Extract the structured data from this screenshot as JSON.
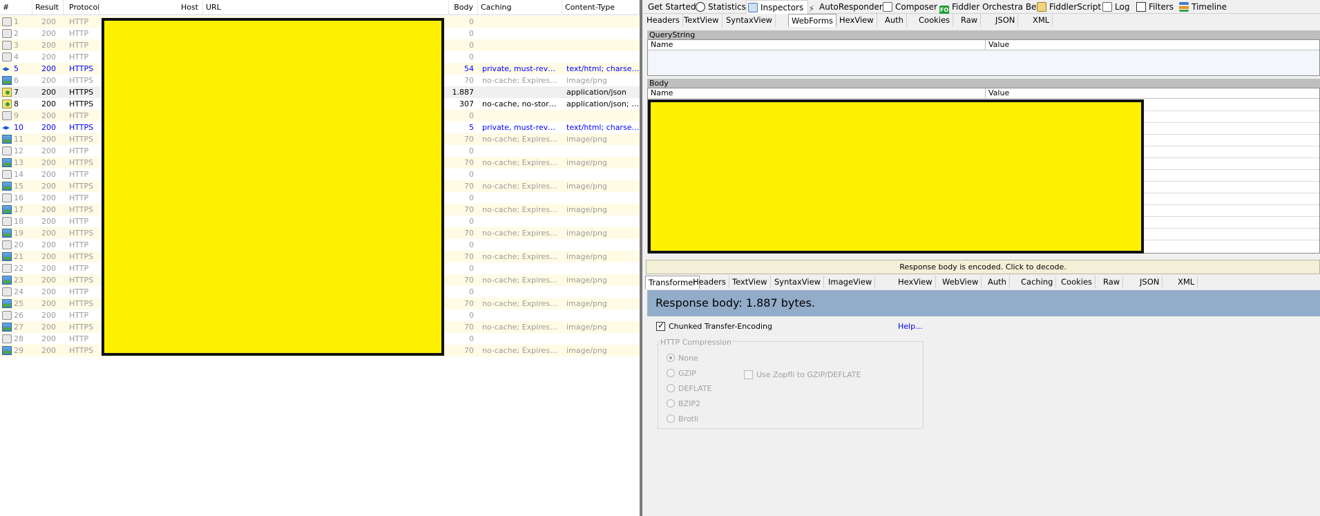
{
  "sessions": {
    "columns": [
      "#",
      "Result",
      "Protocol",
      "Host",
      "URL",
      "Body",
      "Caching",
      "Content-Type"
    ],
    "rows": [
      {
        "num": "1",
        "result": "200",
        "protocol": "HTTP",
        "body": "0",
        "caching": "",
        "ctype": "",
        "icon": "lock-icon",
        "style": "grey"
      },
      {
        "num": "2",
        "result": "200",
        "protocol": "HTTP",
        "body": "0",
        "caching": "",
        "ctype": "",
        "icon": "lock-icon",
        "style": "grey"
      },
      {
        "num": "3",
        "result": "200",
        "protocol": "HTTP",
        "body": "0",
        "caching": "",
        "ctype": "",
        "icon": "lock-icon",
        "style": "grey"
      },
      {
        "num": "4",
        "result": "200",
        "protocol": "HTTP",
        "body": "0",
        "caching": "",
        "ctype": "",
        "icon": "lock-icon",
        "style": "grey"
      },
      {
        "num": "5",
        "result": "200",
        "protocol": "HTTPS",
        "body": "54",
        "caching": "private, must-revali...",
        "ctype": "text/html; charset=UT",
        "icon": "web-arrows-icon",
        "style": "blue"
      },
      {
        "num": "6",
        "result": "200",
        "protocol": "HTTPS",
        "body": "70",
        "caching": "no-cache; Expires: -1",
        "ctype": "image/png",
        "icon": "image-icon",
        "style": "grey"
      },
      {
        "num": "7",
        "result": "200",
        "protocol": "HTTPS",
        "body": "1.887",
        "caching": "",
        "ctype": "application/json",
        "icon": "json-icon",
        "style": "black"
      },
      {
        "num": "8",
        "result": "200",
        "protocol": "HTTPS",
        "body": "307",
        "caching": "no-cache, no-store,...",
        "ctype": "application/json; chars",
        "icon": "json-icon",
        "style": "black"
      },
      {
        "num": "9",
        "result": "200",
        "protocol": "HTTP",
        "body": "0",
        "caching": "",
        "ctype": "",
        "icon": "lock-icon",
        "style": "grey"
      },
      {
        "num": "10",
        "result": "200",
        "protocol": "HTTPS",
        "body": "5",
        "caching": "private, must-revali...",
        "ctype": "text/html; charset=UT",
        "icon": "web-arrows-icon",
        "style": "blue"
      },
      {
        "num": "11",
        "result": "200",
        "protocol": "HTTPS",
        "body": "70",
        "caching": "no-cache; Expires: -1",
        "ctype": "image/png",
        "icon": "image-icon",
        "style": "grey"
      },
      {
        "num": "12",
        "result": "200",
        "protocol": "HTTP",
        "body": "0",
        "caching": "",
        "ctype": "",
        "icon": "lock-icon",
        "style": "grey"
      },
      {
        "num": "13",
        "result": "200",
        "protocol": "HTTPS",
        "body": "70",
        "caching": "no-cache; Expires: -1",
        "ctype": "image/png",
        "icon": "image-icon",
        "style": "grey"
      },
      {
        "num": "14",
        "result": "200",
        "protocol": "HTTP",
        "body": "0",
        "caching": "",
        "ctype": "",
        "icon": "lock-icon",
        "style": "grey"
      },
      {
        "num": "15",
        "result": "200",
        "protocol": "HTTPS",
        "body": "70",
        "caching": "no-cache; Expires: -1",
        "ctype": "image/png",
        "icon": "image-icon",
        "style": "grey"
      },
      {
        "num": "16",
        "result": "200",
        "protocol": "HTTP",
        "body": "0",
        "caching": "",
        "ctype": "",
        "icon": "lock-icon",
        "style": "grey"
      },
      {
        "num": "17",
        "result": "200",
        "protocol": "HTTPS",
        "body": "70",
        "caching": "no-cache; Expires: -1",
        "ctype": "image/png",
        "icon": "image-icon",
        "style": "grey"
      },
      {
        "num": "18",
        "result": "200",
        "protocol": "HTTP",
        "body": "0",
        "caching": "",
        "ctype": "",
        "icon": "lock-icon",
        "style": "grey"
      },
      {
        "num": "19",
        "result": "200",
        "protocol": "HTTPS",
        "body": "70",
        "caching": "no-cache; Expires: -1",
        "ctype": "image/png",
        "icon": "image-icon",
        "style": "grey"
      },
      {
        "num": "20",
        "result": "200",
        "protocol": "HTTP",
        "body": "0",
        "caching": "",
        "ctype": "",
        "icon": "lock-icon",
        "style": "grey"
      },
      {
        "num": "21",
        "result": "200",
        "protocol": "HTTPS",
        "body": "70",
        "caching": "no-cache; Expires: -1",
        "ctype": "image/png",
        "icon": "image-icon",
        "style": "grey"
      },
      {
        "num": "22",
        "result": "200",
        "protocol": "HTTP",
        "body": "0",
        "caching": "",
        "ctype": "",
        "icon": "lock-icon",
        "style": "grey"
      },
      {
        "num": "23",
        "result": "200",
        "protocol": "HTTPS",
        "body": "70",
        "caching": "no-cache; Expires: -1",
        "ctype": "image/png",
        "icon": "image-icon",
        "style": "grey"
      },
      {
        "num": "24",
        "result": "200",
        "protocol": "HTTP",
        "body": "0",
        "caching": "",
        "ctype": "",
        "icon": "lock-icon",
        "style": "grey"
      },
      {
        "num": "25",
        "result": "200",
        "protocol": "HTTPS",
        "body": "70",
        "caching": "no-cache; Expires: -1",
        "ctype": "image/png",
        "icon": "image-icon",
        "style": "grey"
      },
      {
        "num": "26",
        "result": "200",
        "protocol": "HTTP",
        "body": "0",
        "caching": "",
        "ctype": "",
        "icon": "lock-icon",
        "style": "grey"
      },
      {
        "num": "27",
        "result": "200",
        "protocol": "HTTPS",
        "body": "70",
        "caching": "no-cache; Expires: -1",
        "ctype": "image/png",
        "icon": "image-icon",
        "style": "grey"
      },
      {
        "num": "28",
        "result": "200",
        "protocol": "HTTP",
        "body": "0",
        "caching": "",
        "ctype": "",
        "icon": "lock-icon",
        "style": "grey"
      },
      {
        "num": "29",
        "result": "200",
        "protocol": "HTTPS",
        "body": "70",
        "caching": "no-cache; Expires: -1",
        "ctype": "image/png",
        "icon": "image-icon",
        "style": "grey"
      }
    ],
    "selected_row": "7"
  },
  "top_tabs": [
    {
      "label": "Get Started",
      "icon": ""
    },
    {
      "label": "Statistics",
      "icon": "stopwatch-icon"
    },
    {
      "label": "Inspectors",
      "icon": "inspect-icon",
      "active": true
    },
    {
      "label": "AutoResponder",
      "icon": "lightning-icon"
    },
    {
      "label": "Composer",
      "icon": "pencil-icon"
    },
    {
      "label": "Fiddler Orchestra Beta",
      "icon": "fo-icon"
    },
    {
      "label": "FiddlerScript",
      "icon": "script-icon"
    },
    {
      "label": "Log",
      "icon": "log-icon"
    },
    {
      "label": "Filters",
      "icon": "checkbox-icon"
    },
    {
      "label": "Timeline",
      "icon": "timeline-icon"
    }
  ],
  "request_tabs": [
    "Headers",
    "TextView",
    "SyntaxView",
    "WebForms",
    "HexView",
    "Auth",
    "Cookies",
    "Raw",
    "JSON",
    "XML"
  ],
  "request_active_tab": "WebForms",
  "querystring": {
    "title": "QueryString",
    "col_name": "Name",
    "col_value": "Value"
  },
  "body": {
    "title": "Body",
    "col_name": "Name",
    "col_value": "Value"
  },
  "decode_bar": "Response body is encoded. Click to decode.",
  "response_tabs": [
    "Transformer",
    "Headers",
    "TextView",
    "SyntaxView",
    "ImageView",
    "HexView",
    "WebView",
    "Auth",
    "Caching",
    "Cookies",
    "Raw",
    "JSON",
    "XML"
  ],
  "response_active_tab": "Transformer",
  "transformer": {
    "response_body": "Response body: 1.887 bytes.",
    "chunked_label": "Chunked Transfer-Encoding",
    "chunked_checked": true,
    "help_link": "Help...",
    "compression_title": "HTTP Compression",
    "options": [
      "None",
      "GZIP",
      "DEFLATE",
      "BZIP2",
      "Brotli"
    ],
    "selected_option": "None",
    "zopfli_label": "Use Zopfli to GZIP/DEFLATE"
  },
  "colors": {
    "row_alt": "#fffbe5",
    "redaction": "#fff200",
    "link_blue": "#0000ff",
    "response_banner": "#93acc9"
  }
}
